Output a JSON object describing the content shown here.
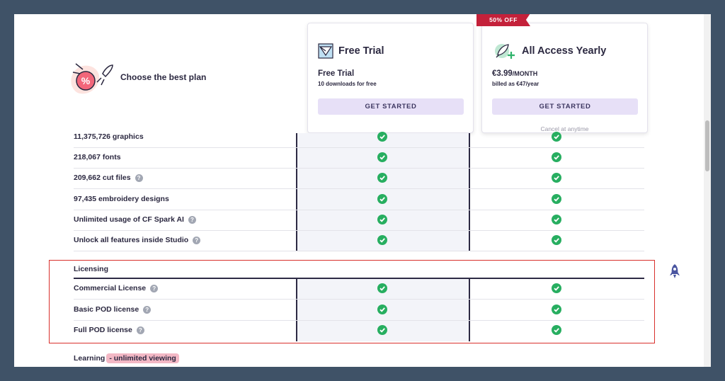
{
  "header": {
    "title": "Choose the best plan"
  },
  "plans": [
    {
      "name": "Free Trial",
      "plan_title": "Free Trial",
      "plan_sub": "10 downloads for free",
      "button": "GET STARTED",
      "icon": "paper-plane-icon"
    },
    {
      "name": "All Access Yearly",
      "badge": "50% OFF",
      "price": "€3.99",
      "unit": "/MONTH",
      "plan_sub": "billed as €47/year",
      "button": "GET STARTED",
      "note": "Cancel at anytime",
      "icon": "rocket-icon"
    }
  ],
  "features": [
    {
      "label": "11,375,726 graphics",
      "help": false
    },
    {
      "label": "218,067 fonts",
      "help": false
    },
    {
      "label": "209,662 cut files",
      "help": true
    },
    {
      "label": "97,435 embroidery designs",
      "help": false
    },
    {
      "label": "Unlimited usage of CF Spark AI",
      "help": true
    },
    {
      "label": "Unlock all features inside Studio",
      "help": true
    }
  ],
  "licensing": {
    "title": "Licensing",
    "rows": [
      {
        "label": "Commercial License",
        "help": true
      },
      {
        "label": "Basic POD license",
        "help": true
      },
      {
        "label": "Full POD license",
        "help": true
      }
    ]
  },
  "learning": {
    "label": "Learning",
    "highlight": "- unlimited viewing"
  },
  "colors": {
    "accent": "#e7e0f7",
    "check": "#27ae60",
    "badge": "#c4213a",
    "frame": "#d9302c"
  }
}
